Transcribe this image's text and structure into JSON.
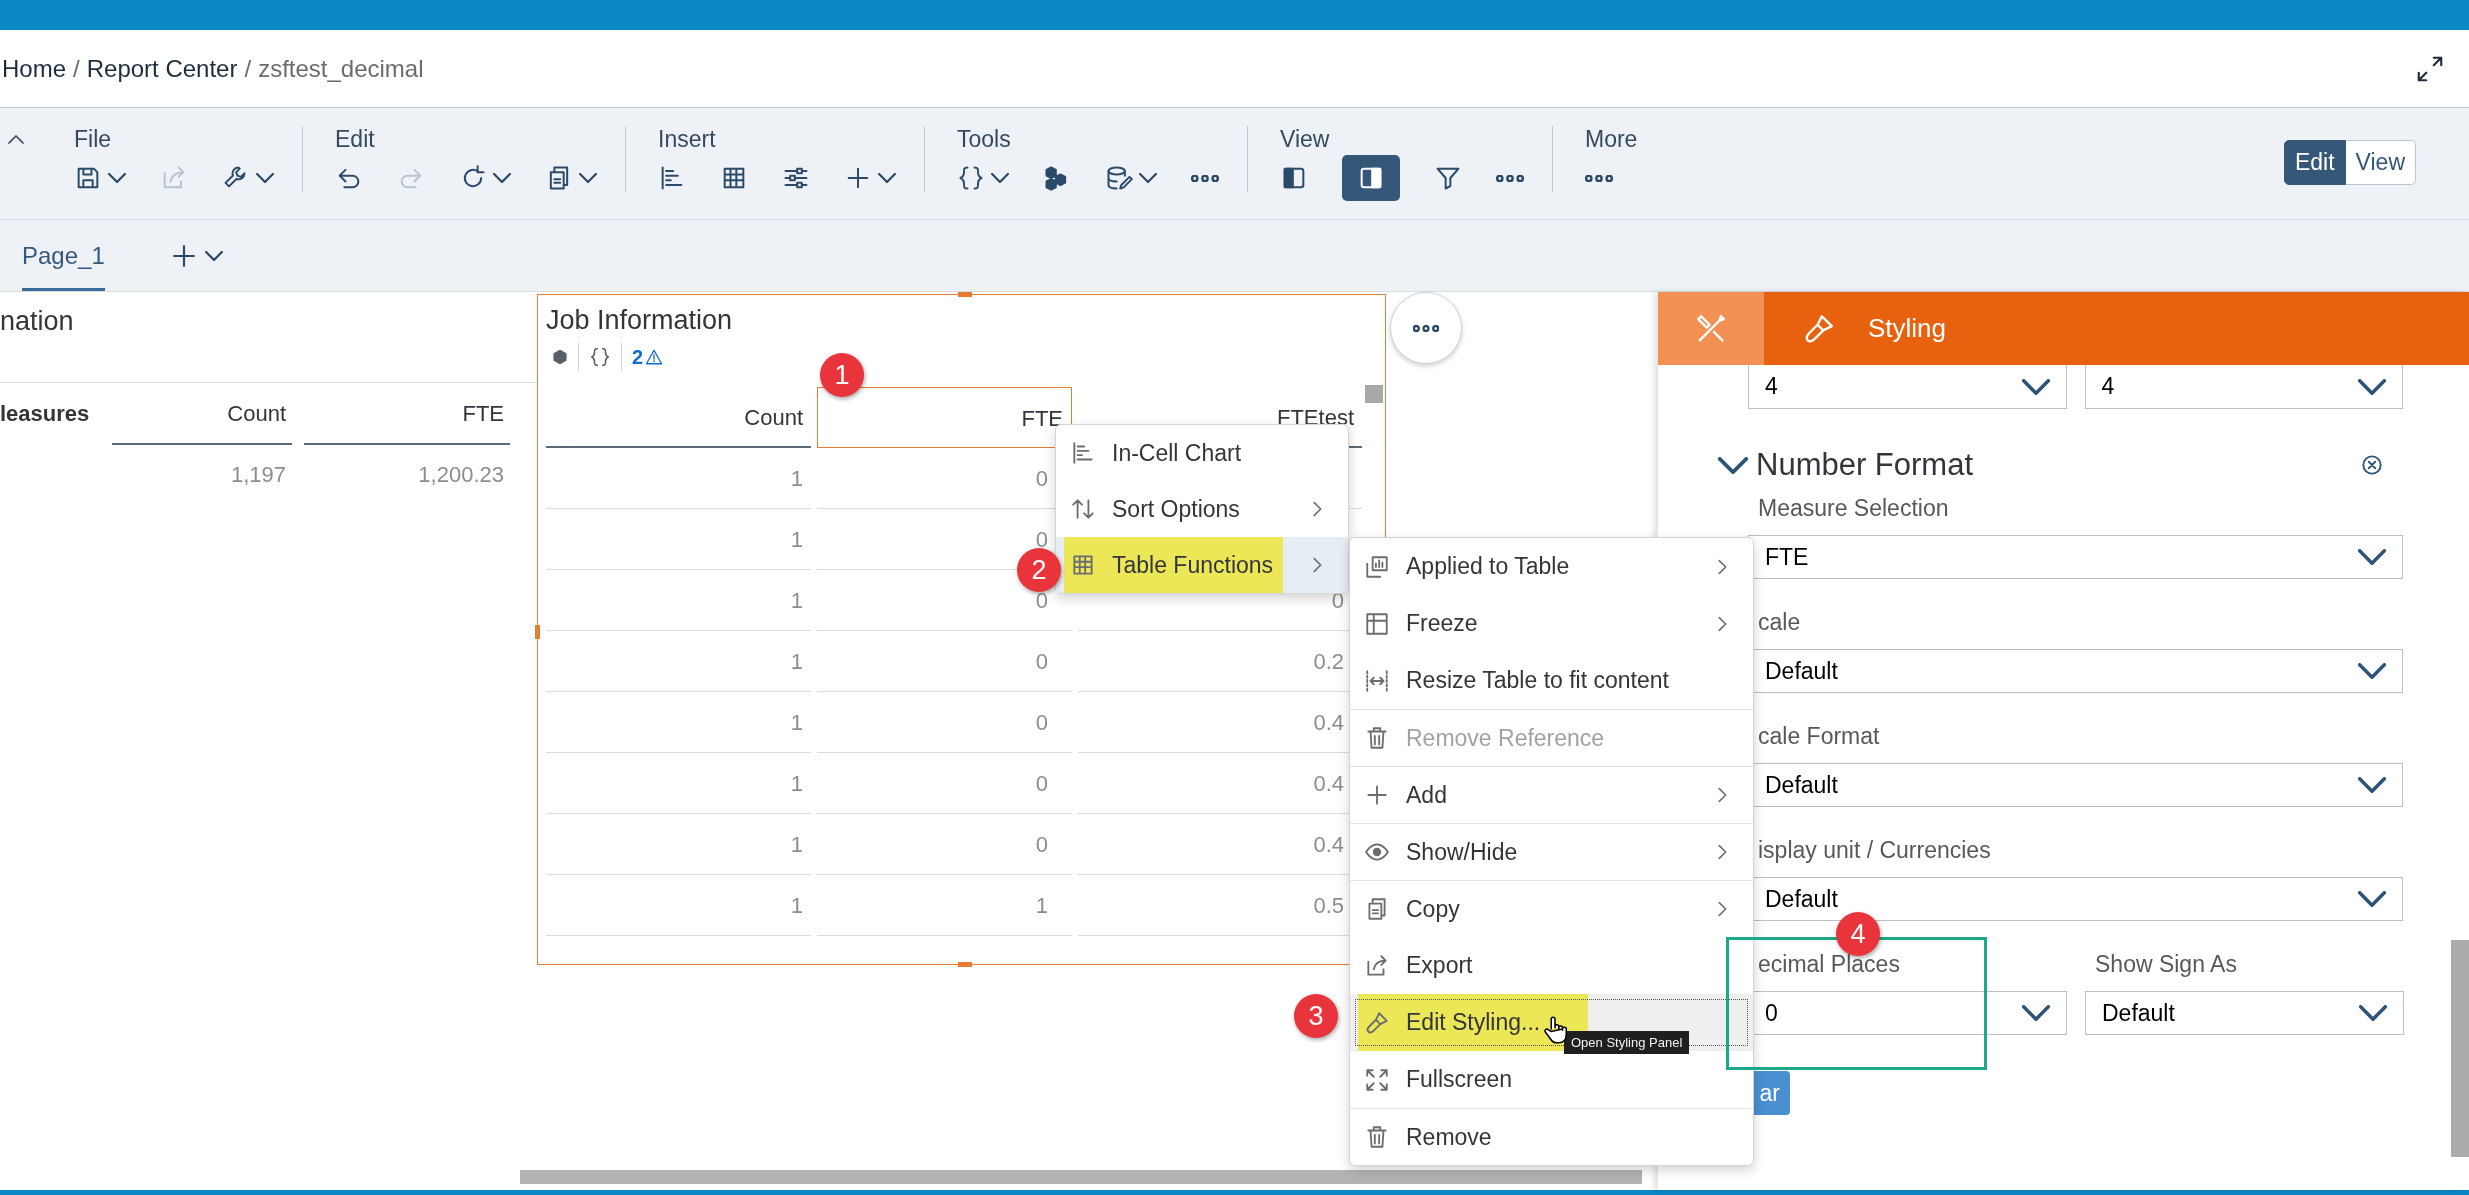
{
  "breadcrumbs": {
    "separator": "/",
    "items": [
      {
        "label": "Home",
        "current": false
      },
      {
        "label": "Report Center",
        "current": false
      },
      {
        "label": "zsftest_decimal",
        "current": true
      }
    ]
  },
  "toolbar_groups": [
    {
      "label": "File",
      "items": [
        {
          "kind": "save",
          "dropdown": true,
          "disabled": false,
          "selected": false
        },
        {
          "kind": "share",
          "dropdown": false,
          "disabled": true,
          "selected": false
        },
        {
          "kind": "wrench",
          "dropdown": true,
          "disabled": false,
          "selected": false
        }
      ]
    },
    {
      "label": "Edit",
      "items": [
        {
          "kind": "undo",
          "dropdown": false,
          "disabled": false,
          "selected": false
        },
        {
          "kind": "redo",
          "dropdown": false,
          "disabled": true,
          "selected": false
        },
        {
          "kind": "refresh",
          "dropdown": true,
          "disabled": false,
          "selected": false
        },
        {
          "kind": "copy",
          "dropdown": true,
          "disabled": false,
          "selected": false
        }
      ]
    },
    {
      "label": "Insert",
      "items": [
        {
          "kind": "barchart",
          "dropdown": false,
          "disabled": false,
          "selected": false
        },
        {
          "kind": "table",
          "dropdown": false,
          "disabled": false,
          "selected": false
        },
        {
          "kind": "sliders",
          "dropdown": false,
          "disabled": false,
          "selected": false
        },
        {
          "kind": "plus",
          "dropdown": true,
          "disabled": false,
          "selected": false
        }
      ]
    },
    {
      "label": "Tools",
      "items": [
        {
          "kind": "braces",
          "dropdown": true,
          "disabled": false,
          "selected": false
        },
        {
          "kind": "cubes",
          "dropdown": false,
          "disabled": false,
          "selected": false
        },
        {
          "kind": "dbedit",
          "dropdown": true,
          "disabled": false,
          "selected": false
        },
        {
          "kind": "more",
          "dropdown": false,
          "disabled": false,
          "selected": false
        }
      ]
    },
    {
      "label": "View",
      "items": [
        {
          "kind": "panelleft",
          "dropdown": false,
          "disabled": false,
          "selected": false
        },
        {
          "kind": "panelright",
          "dropdown": false,
          "disabled": false,
          "selected": true
        },
        {
          "kind": "filter",
          "dropdown": false,
          "disabled": false,
          "selected": false
        },
        {
          "kind": "more",
          "dropdown": false,
          "disabled": false,
          "selected": false
        }
      ]
    },
    {
      "label": "More",
      "items": [
        {
          "kind": "more",
          "dropdown": false,
          "disabled": false,
          "selected": false
        }
      ]
    }
  ],
  "mode_switch": [
    {
      "label": "Edit",
      "selected": true
    },
    {
      "label": "View",
      "selected": false
    }
  ],
  "pages": [
    {
      "label": "Page_1",
      "selected": true
    }
  ],
  "left_table": {
    "title": "nation",
    "header": [
      "leasures",
      "Count",
      "FTE"
    ],
    "rows": [
      [
        "1,197",
        "1,200.23"
      ]
    ]
  },
  "widget": {
    "title": "Job Information",
    "warning_count": "2",
    "columns": [
      {
        "label": "Count",
        "selected": false
      },
      {
        "label": "FTE",
        "selected": true
      },
      {
        "label": "FTEtest",
        "selected": false
      }
    ],
    "rows": [
      [
        "1",
        "0"
      ],
      [
        "1",
        "0"
      ],
      [
        "1",
        "0",
        "0"
      ],
      [
        "1",
        "0",
        "0.2"
      ],
      [
        "1",
        "0",
        "0.4"
      ],
      [
        "1",
        "0",
        "0.4"
      ],
      [
        "1",
        "0",
        "0.4"
      ],
      [
        "1",
        "1",
        "0.5"
      ]
    ]
  },
  "context_menu": {
    "items": [
      {
        "label": "In-Cell Chart",
        "kind": "barchart",
        "submenu": false,
        "selected": false,
        "highlighted": false
      },
      {
        "label": "Sort Options",
        "kind": "sort",
        "submenu": true,
        "selected": false,
        "highlighted": false
      },
      {
        "label": "Table Functions",
        "kind": "table",
        "submenu": true,
        "selected": true,
        "highlighted": true
      }
    ]
  },
  "submenu": {
    "items": [
      {
        "label": "Applied to Table",
        "kind": "applied",
        "submenu": true,
        "disabled": false,
        "selected": false,
        "highlighted": false,
        "separated": false
      },
      {
        "label": "Freeze",
        "kind": "freeze",
        "submenu": true,
        "disabled": false,
        "selected": false,
        "highlighted": false,
        "separated": false
      },
      {
        "label": "Resize Table to fit content",
        "kind": "resize",
        "submenu": false,
        "disabled": false,
        "selected": false,
        "highlighted": false,
        "separated": false
      },
      {
        "label": "Remove Reference",
        "kind": "trash",
        "submenu": false,
        "disabled": true,
        "selected": false,
        "highlighted": false,
        "separated": true
      },
      {
        "label": "Add",
        "kind": "plus",
        "submenu": true,
        "disabled": false,
        "selected": false,
        "highlighted": false,
        "separated": true
      },
      {
        "label": "Show/Hide",
        "kind": "eye",
        "submenu": true,
        "disabled": false,
        "selected": false,
        "highlighted": false,
        "separated": true
      },
      {
        "label": "Copy",
        "kind": "copy",
        "submenu": true,
        "disabled": false,
        "selected": false,
        "highlighted": false,
        "separated": true
      },
      {
        "label": "Export",
        "kind": "share",
        "submenu": false,
        "disabled": false,
        "selected": false,
        "highlighted": false,
        "separated": false
      },
      {
        "label": "Edit Styling...",
        "kind": "brush",
        "submenu": false,
        "disabled": false,
        "selected": true,
        "highlighted": true,
        "separated": false
      },
      {
        "label": "Fullscreen",
        "kind": "fullscreen",
        "submenu": false,
        "disabled": false,
        "selected": false,
        "highlighted": false,
        "separated": false
      },
      {
        "label": "Remove",
        "kind": "trash",
        "submenu": false,
        "disabled": false,
        "selected": false,
        "highlighted": false,
        "separated": true
      }
    ]
  },
  "tooltip": "Open Styling Panel",
  "markers": [
    "1",
    "2",
    "3",
    "4"
  ],
  "styling_panel": {
    "tabs": [
      {
        "kind": "tools",
        "selected": false
      },
      {
        "kind": "brush",
        "label": "Styling",
        "selected": true
      }
    ],
    "top_dropdowns": [
      "4",
      "4"
    ],
    "section": {
      "title": "Number Format",
      "expanded": true
    },
    "fields": [
      {
        "label": "Measure Selection",
        "value": "FTE"
      },
      {
        "label": "cale",
        "value": "Default"
      },
      {
        "label": "cale Format",
        "value": "Default"
      },
      {
        "label": "isplay unit / Currencies",
        "value": "Default"
      }
    ],
    "field_pair": [
      {
        "label": "ecimal Places",
        "value": "0"
      },
      {
        "label": "Show Sign As",
        "value": "Default"
      }
    ],
    "button": "ar"
  }
}
